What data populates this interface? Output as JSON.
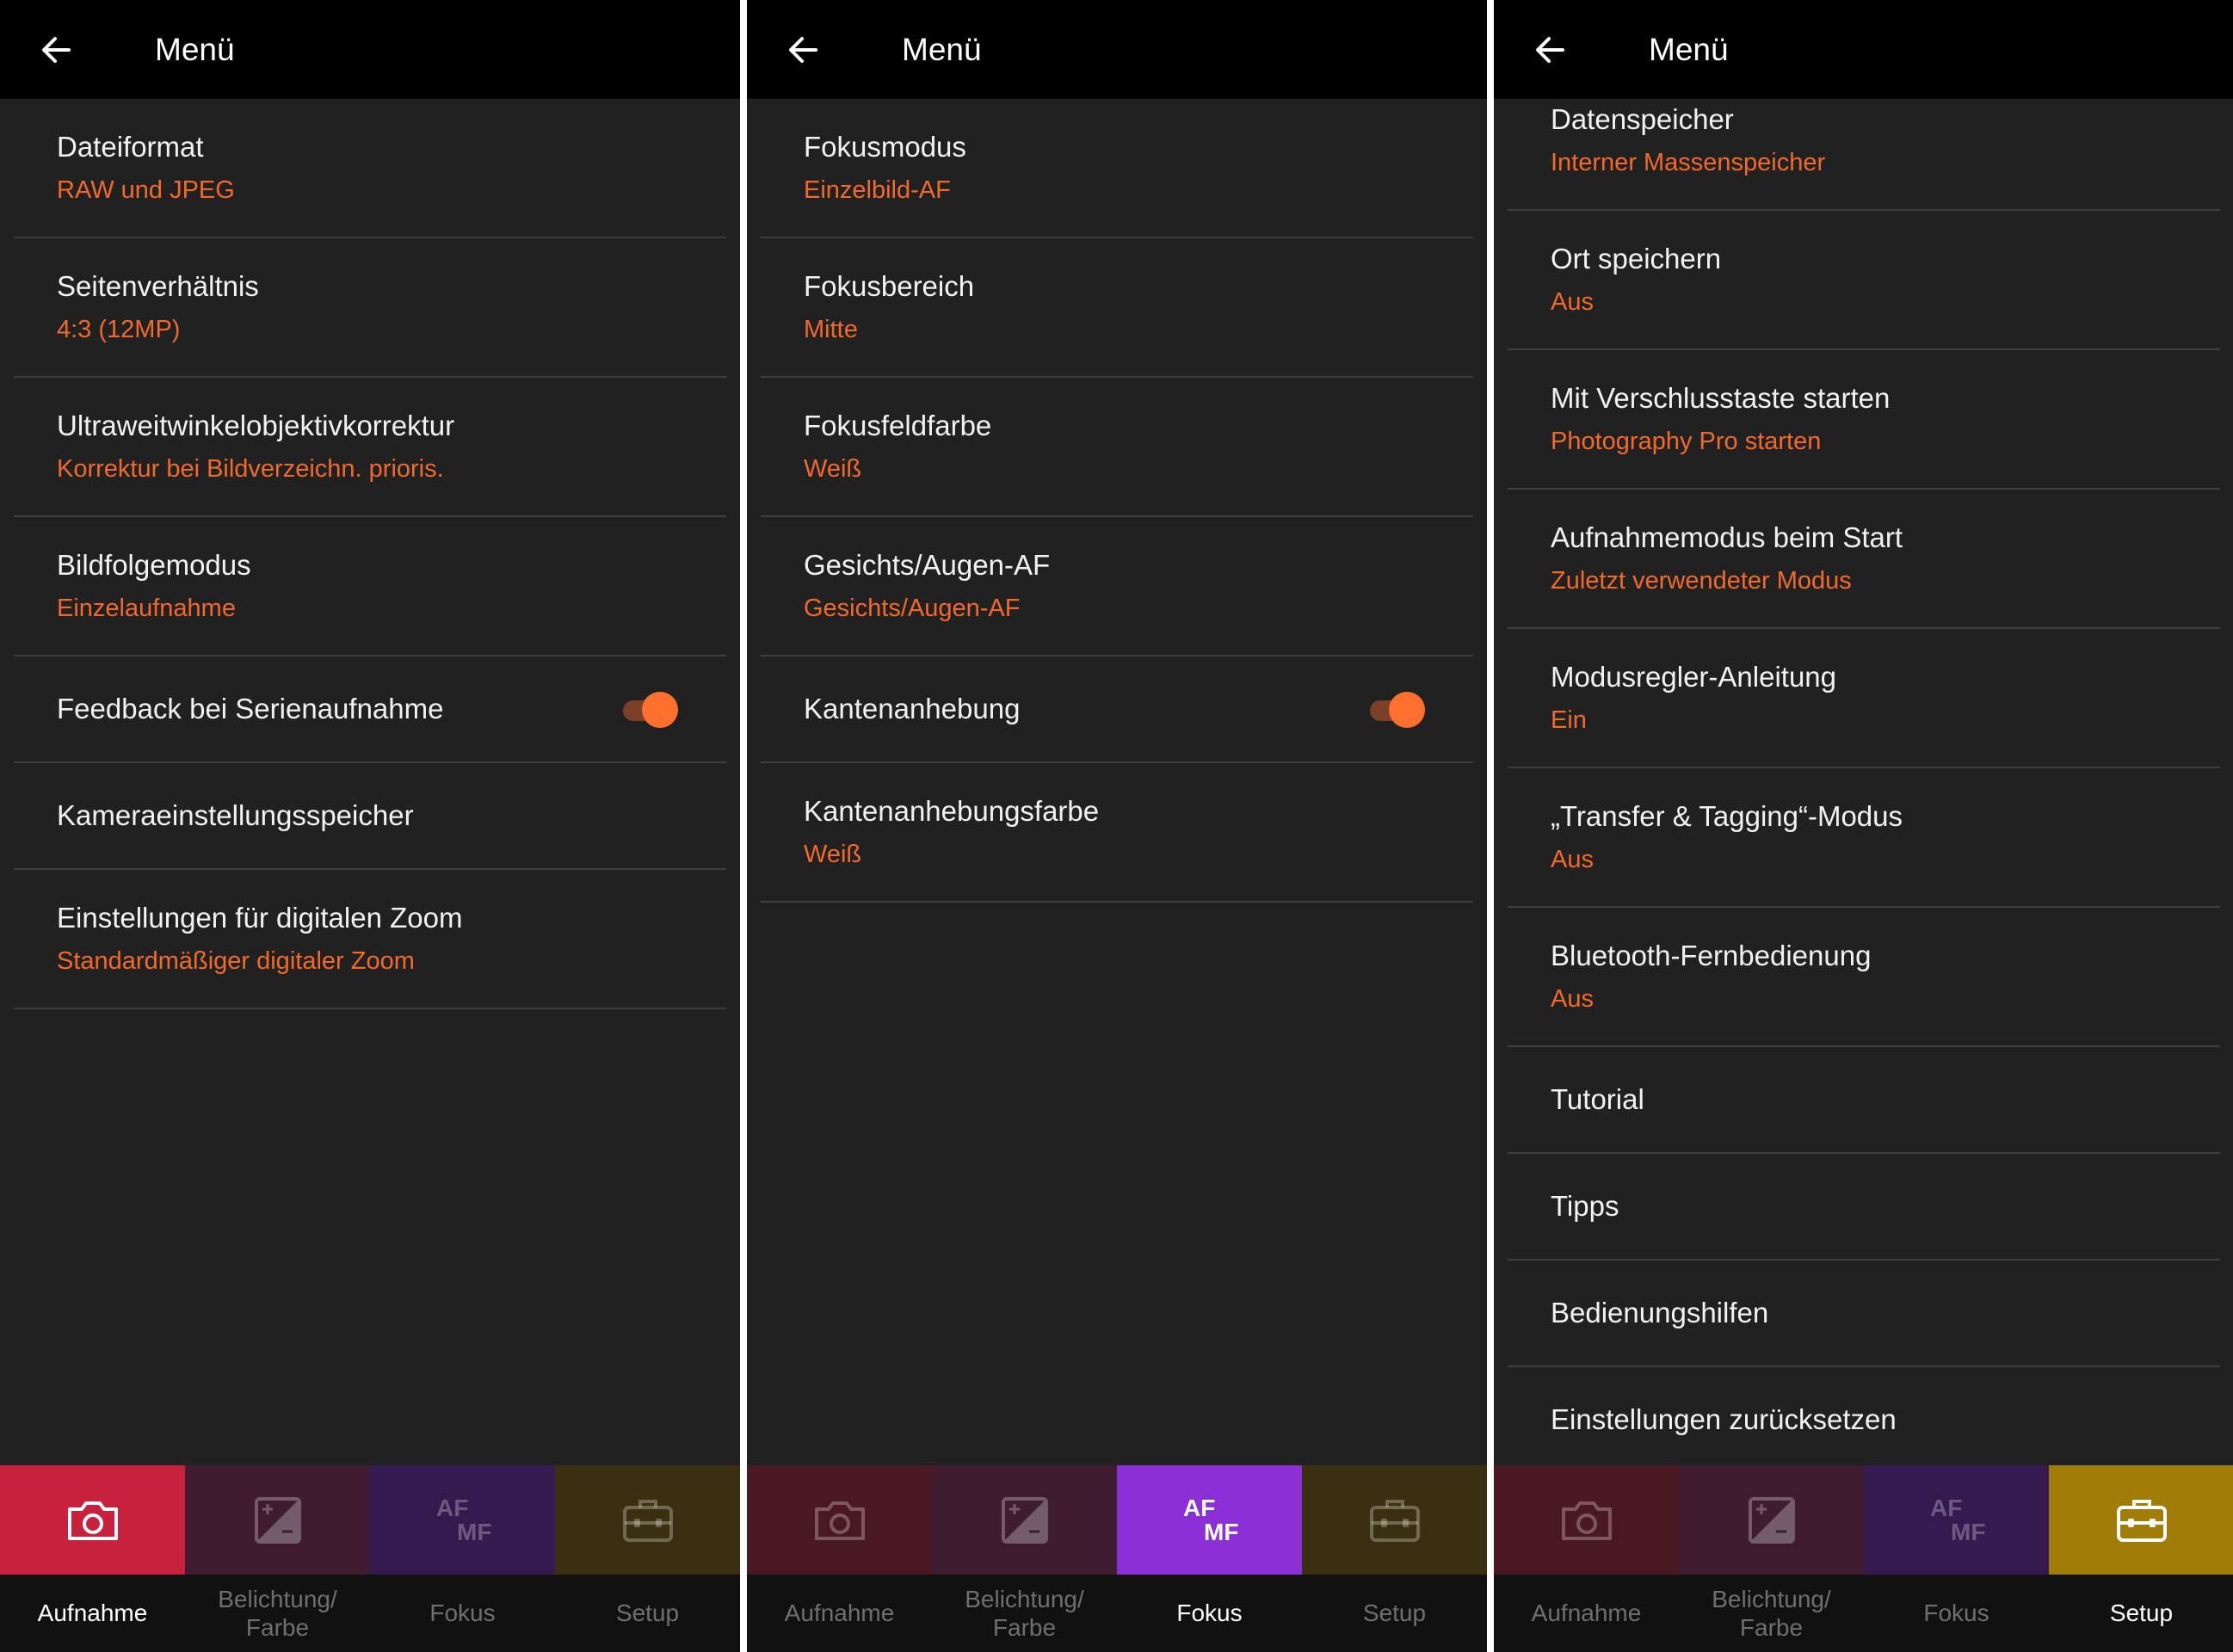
{
  "colors": {
    "background": "#212121",
    "appbar": "#000000",
    "accent_text": "#f26a2a",
    "toggle_on": "#ff6f2e",
    "tab_aufnahme_active": "#c8213e",
    "tab_aufnahme_dim": "#4a1820",
    "tab_belichtung_dim": "#3f1c30",
    "tab_fokus_active": "#8b2fd6",
    "tab_fokus_dim": "#341a4e",
    "tab_setup_active": "#a07c08",
    "tab_setup_dim": "#3a3010"
  },
  "panels": [
    {
      "appbar": {
        "title": "Menü",
        "back_icon": "arrow-left-icon"
      },
      "items": [
        {
          "title": "Dateiformat",
          "subtitle": "RAW und JPEG"
        },
        {
          "title": "Seitenverhältnis",
          "subtitle": "4:3 (12MP)"
        },
        {
          "title": "Ultraweitwinkelobjektivkorrektur",
          "subtitle": "Korrektur bei Bildverzeichn. prioris."
        },
        {
          "title": "Bildfolgemodus",
          "subtitle": "Einzelaufnahme"
        },
        {
          "title": "Feedback bei Serienaufnahme",
          "toggle": true
        },
        {
          "title": "Kameraeinstellungsspeicher"
        },
        {
          "title": "Einstellungen für digitalen Zoom",
          "subtitle": "Standardmäßiger digitaler Zoom"
        }
      ],
      "active_tab": "Aufnahme"
    },
    {
      "appbar": {
        "title": "Menü",
        "back_icon": "arrow-left-icon"
      },
      "items": [
        {
          "title": "Fokusmodus",
          "subtitle": "Einzelbild-AF"
        },
        {
          "title": "Fokusbereich",
          "subtitle": "Mitte"
        },
        {
          "title": "Fokusfeldfarbe",
          "subtitle": "Weiß"
        },
        {
          "title": "Gesichts/Augen-AF",
          "subtitle": "Gesichts/Augen-AF"
        },
        {
          "title": "Kantenanhebung",
          "toggle": true
        },
        {
          "title": "Kantenanhebungsfarbe",
          "subtitle": "Weiß"
        }
      ],
      "active_tab": "Fokus"
    },
    {
      "appbar": {
        "title": "Menü",
        "back_icon": "arrow-left-icon"
      },
      "items": [
        {
          "title": "Datenspeicher",
          "subtitle": "Interner Massenspeicher"
        },
        {
          "title": "Ort speichern",
          "subtitle": "Aus"
        },
        {
          "title": "Mit Verschlusstaste starten",
          "subtitle": "Photography Pro starten"
        },
        {
          "title": "Aufnahmemodus beim Start",
          "subtitle": "Zuletzt verwendeter Modus"
        },
        {
          "title": "Modusregler-Anleitung",
          "subtitle": "Ein"
        },
        {
          "title": "„Transfer & Tagging“-Modus",
          "subtitle": "Aus"
        },
        {
          "title": "Bluetooth-Fernbedienung",
          "subtitle": "Aus"
        },
        {
          "title": "Tutorial"
        },
        {
          "title": "Tipps"
        },
        {
          "title": "Bedienungshilfen"
        },
        {
          "title": "Einstellungen zurücksetzen"
        }
      ],
      "active_tab": "Setup"
    }
  ],
  "tabs": [
    {
      "id": "Aufnahme",
      "label": "Aufnahme",
      "icon": "camera-icon"
    },
    {
      "id": "Belichtung",
      "label": "Belichtung/\nFarbe",
      "icon": "exposure-icon"
    },
    {
      "id": "Fokus",
      "label": "Fokus",
      "icon": "af-mf-icon",
      "icon_text_top": "AF",
      "icon_text_bottom": "MF"
    },
    {
      "id": "Setup",
      "label": "Setup",
      "icon": "toolbox-icon"
    }
  ]
}
